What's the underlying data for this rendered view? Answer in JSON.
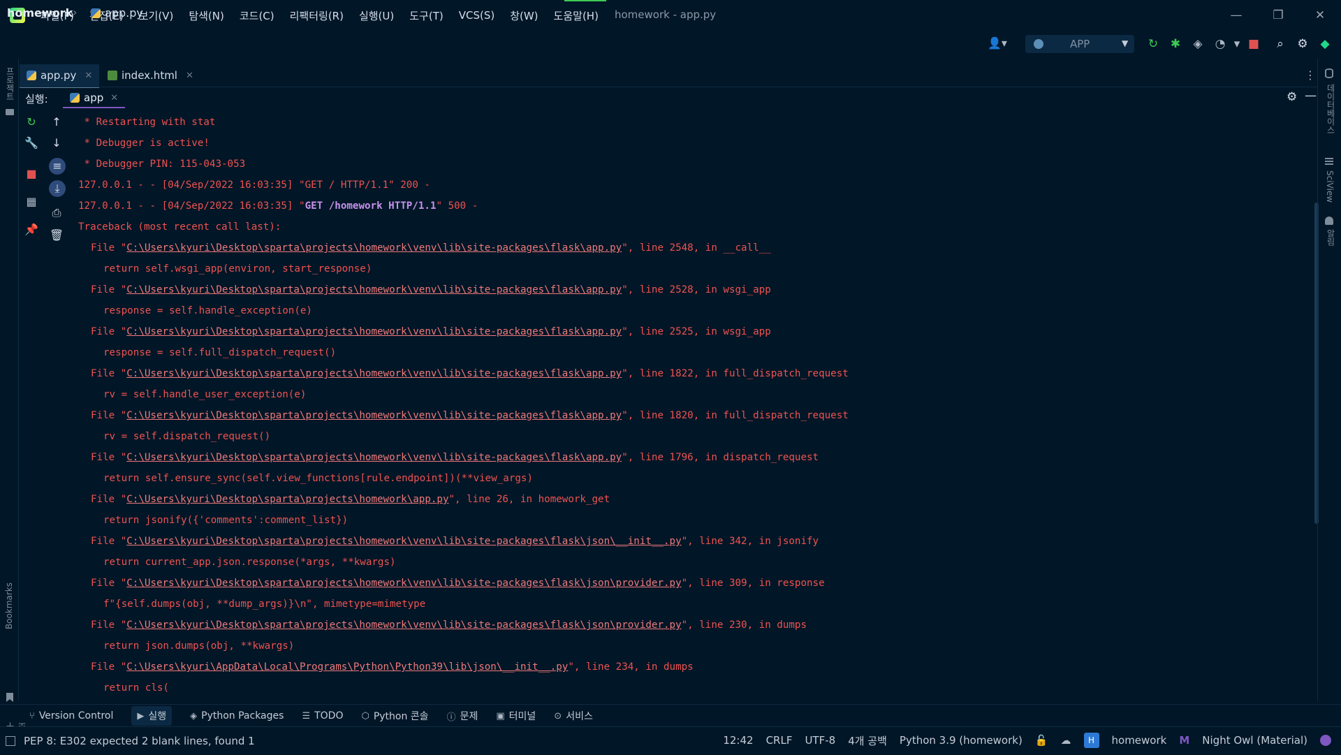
{
  "menu": [
    "파일(F)",
    "편집(E)",
    "보기(V)",
    "탐색(N)",
    "코드(C)",
    "리팩터링(R)",
    "실행(U)",
    "도구(T)",
    "VCS(S)",
    "창(W)",
    "도움말(H)"
  ],
  "window_title": "homework - app.py",
  "window_controls": {
    "minimize": "—",
    "restore": "❐",
    "close": "✕"
  },
  "breadcrumb": {
    "project": "homework",
    "separator": "›",
    "file": "app.py"
  },
  "toolbar": {
    "user_icon": "👤▾",
    "run_config": "APP",
    "run_config_caret": "▼",
    "icons": [
      {
        "name": "rerun-icon",
        "glyph": "↻",
        "color": "#3ecb55"
      },
      {
        "name": "debug-icon",
        "glyph": "✱",
        "color": "#3ecb55"
      },
      {
        "name": "coverage-icon",
        "glyph": "◈",
        "color": "#aeb8c4"
      },
      {
        "name": "profile-icon",
        "glyph": "◔",
        "color": "#aeb8c4"
      },
      {
        "name": "more-run-icon",
        "glyph": "▾",
        "color": "#aeb8c4"
      },
      {
        "name": "stop-icon",
        "glyph": "■",
        "color": "#e05252"
      },
      {
        "name": "search-icon",
        "glyph": "⌕",
        "color": "#d6deeb"
      },
      {
        "name": "settings-icon",
        "glyph": "⚙",
        "color": "#d6deeb"
      },
      {
        "name": "plugin-icon",
        "glyph": "◆",
        "color": "#21d789"
      }
    ]
  },
  "left_strip": {
    "project_label": "프로젝트",
    "bookmarks_label": "Bookmarks",
    "structure_label": "구조"
  },
  "right_strip": {
    "database_label": "데이터베이스",
    "sciview_label": "SciView",
    "notifications_label": "알림"
  },
  "tabs": [
    {
      "label": "app.py",
      "close": "✕"
    },
    {
      "label": "index.html",
      "close": "✕"
    }
  ],
  "run_panel": {
    "label": "실행:",
    "tab": "app",
    "close": "✕",
    "gear": "⚙",
    "hide": "—"
  },
  "run_toolbar": {
    "col1": [
      {
        "name": "rerun-icon",
        "glyph": "↻",
        "color": "#3ecb55"
      },
      {
        "name": "wrench-icon",
        "glyph": "🔧",
        "color": "#aeb8c4"
      },
      {
        "name": "stop-icon",
        "glyph": "■",
        "color": "#e05252"
      },
      {
        "name": "layout-icon",
        "glyph": "▦",
        "color": "#aeb8c4"
      },
      {
        "name": "pin-icon",
        "glyph": "📌",
        "color": "#aeb8c4"
      }
    ],
    "col2": [
      {
        "name": "arrow-up-icon",
        "glyph": "↑",
        "color": "#d6deeb"
      },
      {
        "name": "arrow-down-icon",
        "glyph": "↓",
        "color": "#d6deeb"
      },
      {
        "name": "soft-wrap-icon",
        "glyph": "≡",
        "color": "#d6deeb"
      },
      {
        "name": "scroll-end-icon",
        "glyph": "⤓",
        "color": "#d6deeb"
      },
      {
        "name": "print-icon",
        "glyph": "⎙",
        "color": "#d6deeb"
      },
      {
        "name": "trash-icon",
        "glyph": "🗑",
        "color": "#d6deeb"
      }
    ]
  },
  "console_lines": [
    {
      "indent": 1,
      "pre": " * Restarting with stat"
    },
    {
      "indent": 1,
      "pre": " * Debugger is active!"
    },
    {
      "indent": 1,
      "pre": " * Debugger PIN: 115-043-053"
    },
    {
      "indent": 0,
      "pre": "127.0.0.1 - - [04/Sep/2022 16:03:35] \"GET / HTTP/1.1\" 200 -"
    },
    {
      "indent": 0,
      "pre": "127.0.0.1 - - [04/Sep/2022 16:03:35] \"",
      "hl": "GET /homework HTTP/1.1",
      "post": "\" 500 -"
    },
    {
      "indent": 0,
      "pre": "Traceback (most recent call last):"
    },
    {
      "indent": 2,
      "pre": "File \"",
      "path": "C:\\Users\\kyuri\\Desktop\\sparta\\projects\\homework\\venv\\lib\\site-packages\\flask\\app.py",
      "post": "\", line 2548, in __call__"
    },
    {
      "indent": 3,
      "pre": "return self.wsgi_app(environ, start_response)"
    },
    {
      "indent": 2,
      "pre": "File \"",
      "path": "C:\\Users\\kyuri\\Desktop\\sparta\\projects\\homework\\venv\\lib\\site-packages\\flask\\app.py",
      "post": "\", line 2528, in wsgi_app"
    },
    {
      "indent": 3,
      "pre": "response = self.handle_exception(e)"
    },
    {
      "indent": 2,
      "pre": "File \"",
      "path": "C:\\Users\\kyuri\\Desktop\\sparta\\projects\\homework\\venv\\lib\\site-packages\\flask\\app.py",
      "post": "\", line 2525, in wsgi_app"
    },
    {
      "indent": 3,
      "pre": "response = self.full_dispatch_request()"
    },
    {
      "indent": 2,
      "pre": "File \"",
      "path": "C:\\Users\\kyuri\\Desktop\\sparta\\projects\\homework\\venv\\lib\\site-packages\\flask\\app.py",
      "post": "\", line 1822, in full_dispatch_request"
    },
    {
      "indent": 3,
      "pre": "rv = self.handle_user_exception(e)"
    },
    {
      "indent": 2,
      "pre": "File \"",
      "path": "C:\\Users\\kyuri\\Desktop\\sparta\\projects\\homework\\venv\\lib\\site-packages\\flask\\app.py",
      "post": "\", line 1820, in full_dispatch_request"
    },
    {
      "indent": 3,
      "pre": "rv = self.dispatch_request()"
    },
    {
      "indent": 2,
      "pre": "File \"",
      "path": "C:\\Users\\kyuri\\Desktop\\sparta\\projects\\homework\\venv\\lib\\site-packages\\flask\\app.py",
      "post": "\", line 1796, in dispatch_request"
    },
    {
      "indent": 3,
      "pre": "return self.ensure_sync(self.view_functions[rule.endpoint])(**view_args)"
    },
    {
      "indent": 2,
      "pre": "File \"",
      "path": "C:\\Users\\kyuri\\Desktop\\sparta\\projects\\homework\\app.py",
      "post": "\", line 26, in homework_get"
    },
    {
      "indent": 3,
      "pre": "return jsonify({'comments':comment_list})"
    },
    {
      "indent": 2,
      "pre": "File \"",
      "path": "C:\\Users\\kyuri\\Desktop\\sparta\\projects\\homework\\venv\\lib\\site-packages\\flask\\json\\__init__.py",
      "post": "\", line 342, in jsonify"
    },
    {
      "indent": 3,
      "pre": "return current_app.json.response(*args, **kwargs)"
    },
    {
      "indent": 2,
      "pre": "File \"",
      "path": "C:\\Users\\kyuri\\Desktop\\sparta\\projects\\homework\\venv\\lib\\site-packages\\flask\\json\\provider.py",
      "post": "\", line 309, in response"
    },
    {
      "indent": 3,
      "pre": "f\"{self.dumps(obj, **dump_args)}\\n\", mimetype=mimetype"
    },
    {
      "indent": 2,
      "pre": "File \"",
      "path": "C:\\Users\\kyuri\\Desktop\\sparta\\projects\\homework\\venv\\lib\\site-packages\\flask\\json\\provider.py",
      "post": "\", line 230, in dumps"
    },
    {
      "indent": 3,
      "pre": "return json.dumps(obj, **kwargs)"
    },
    {
      "indent": 2,
      "pre": "File \"",
      "path": "C:\\Users\\kyuri\\AppData\\Local\\Programs\\Python\\Python39\\lib\\json\\__init__.py",
      "post": "\", line 234, in dumps"
    },
    {
      "indent": 3,
      "pre": "return cls("
    }
  ],
  "tool_windows": [
    {
      "name": "version-control",
      "icon": "⑂",
      "label": "Version Control"
    },
    {
      "name": "run",
      "icon": "▶",
      "label": "실행",
      "active": true
    },
    {
      "name": "python-packages",
      "icon": "◈",
      "label": "Python Packages"
    },
    {
      "name": "todo",
      "icon": "☰",
      "label": "TODO"
    },
    {
      "name": "python-console",
      "icon": "⬡",
      "label": "Python 콘솔"
    },
    {
      "name": "problems",
      "icon": "ⓘ",
      "label": "문제"
    },
    {
      "name": "terminal",
      "icon": "▣",
      "label": "터미널"
    },
    {
      "name": "services",
      "icon": "⊙",
      "label": "서비스"
    }
  ],
  "status": {
    "message": "PEP 8: E302 expected 2 blank lines, found 1",
    "position": "12:42",
    "line_separator": "CRLF",
    "encoding": "UTF-8",
    "indent": "4개 공백",
    "interpreter": "Python 3.9 (homework)",
    "badge": "H",
    "project": "homework",
    "theme": "Night Owl (Material)"
  }
}
